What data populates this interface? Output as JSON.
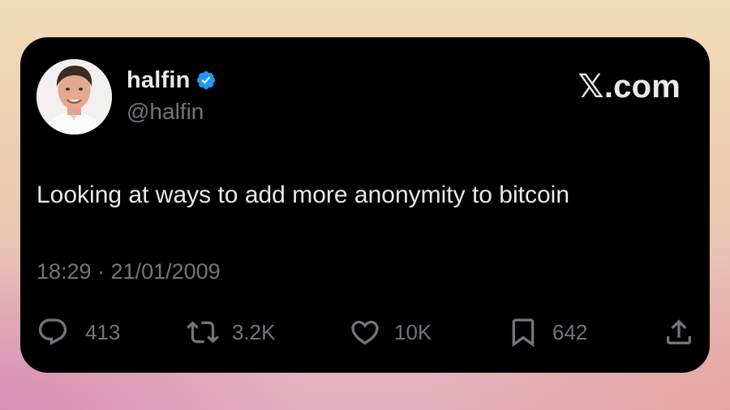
{
  "tweet": {
    "author": {
      "display_name": "halfin",
      "handle": "@halfin",
      "verified": true
    },
    "brand": "𝕏.com",
    "text": "Looking at ways to add more anonymity to bitcoin",
    "timestamp": "18:29 · 21/01/2009",
    "stats": {
      "replies": "413",
      "retweets": "3.2K",
      "likes": "10K",
      "bookmarks": "642"
    }
  },
  "icons": {
    "avatar": "profile-photo",
    "verified": "verified-badge-icon",
    "reply": "reply-icon",
    "retweet": "retweet-icon",
    "like": "heart-icon",
    "bookmark": "bookmark-icon",
    "share": "share-icon"
  },
  "colors": {
    "card_background": "#000000",
    "primary_text": "#e7e9ea",
    "secondary_text": "#71767b",
    "verified_blue": "#1d9bf0"
  }
}
